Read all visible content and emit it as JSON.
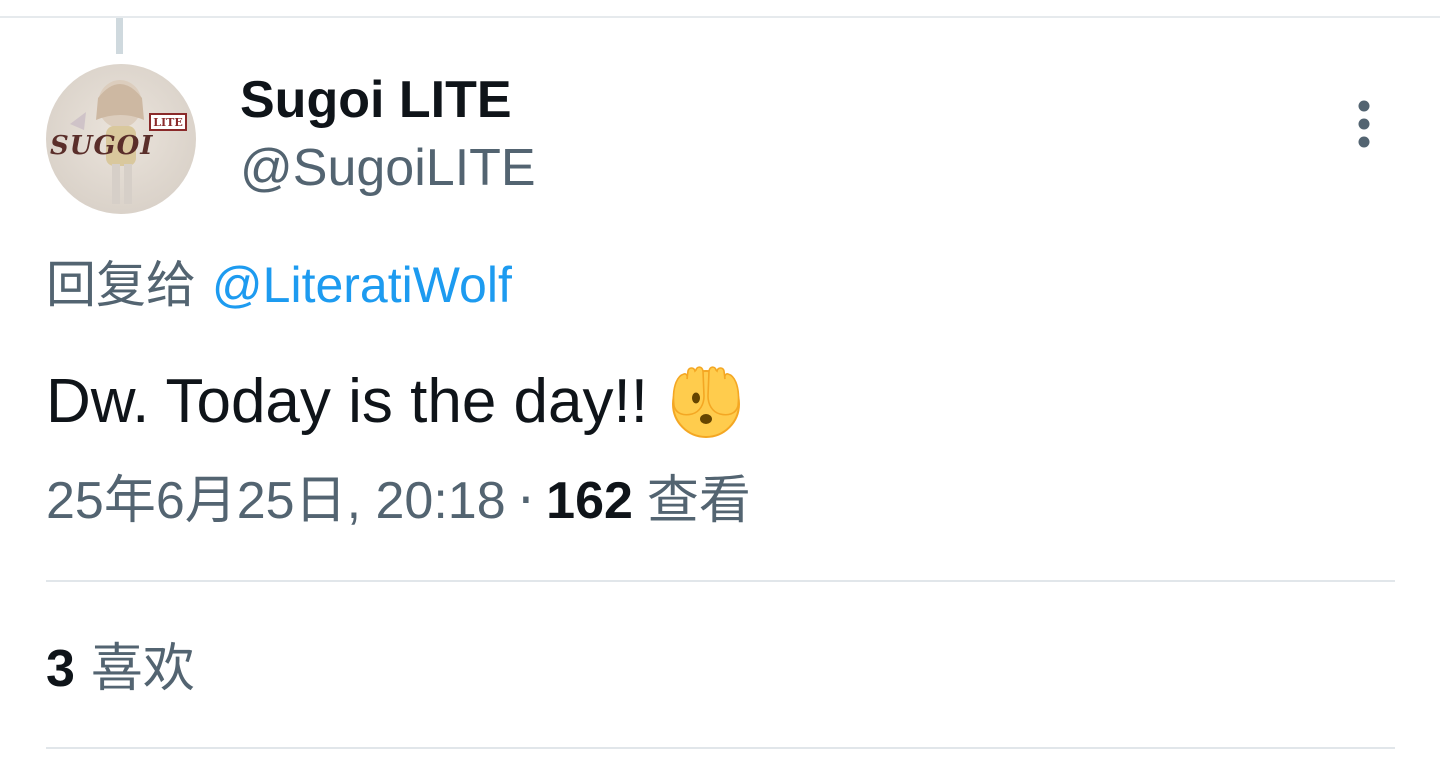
{
  "tweet": {
    "author": {
      "display_name": "Sugoi LITE",
      "handle": "@SugoiLITE",
      "avatar": {
        "logo_text": "SUGOI",
        "badge_text": "LITE"
      }
    },
    "reply": {
      "prefix": "回复给",
      "target": "@LiteratiWolf"
    },
    "text": "Dw. Today is the day!!",
    "emoji": "face-with-peeking-eye-icon",
    "timestamp": "25年6月25日, 20:18",
    "separator": "·",
    "views_count": "162",
    "views_label": "查看",
    "likes_count": "3",
    "likes_label": "喜欢"
  },
  "colors": {
    "text_primary": "#0f1419",
    "text_secondary": "#536471",
    "link": "#1d9bf0",
    "divider": "#e1e6ea"
  }
}
